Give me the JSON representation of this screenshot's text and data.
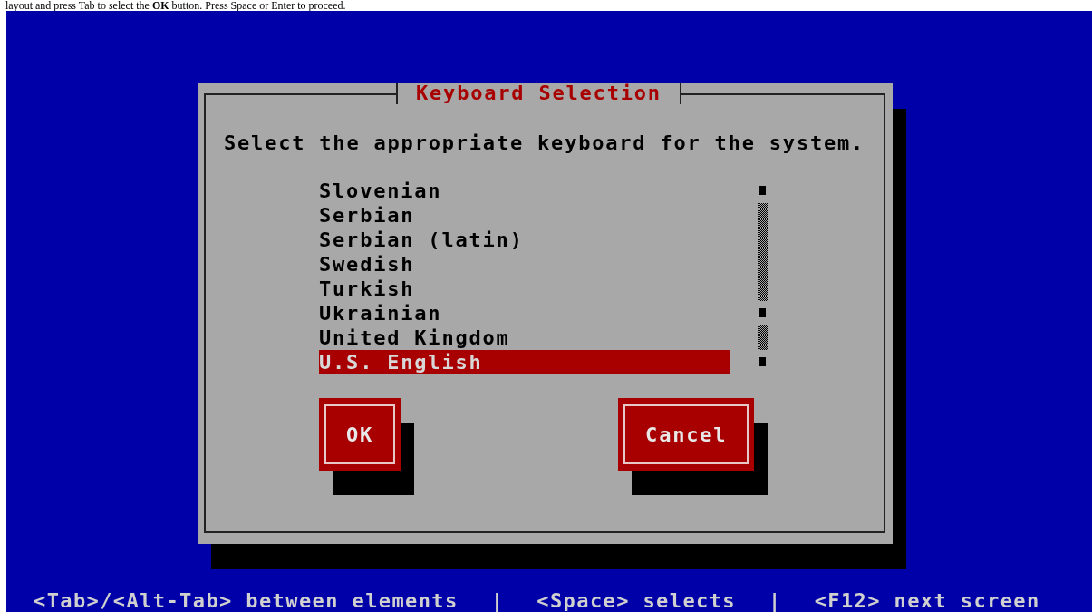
{
  "instruction": "layout and press Tab to select the **OK** button. Press Space or Enter to proceed.",
  "dialog": {
    "title": "Keyboard Selection",
    "prompt": "Select the appropriate keyboard for the system.",
    "options": [
      {
        "label": "Slovenian",
        "selected": false
      },
      {
        "label": "Serbian",
        "selected": false
      },
      {
        "label": "Serbian (latin)",
        "selected": false
      },
      {
        "label": "Swedish",
        "selected": false
      },
      {
        "label": "Turkish",
        "selected": false
      },
      {
        "label": "Ukrainian",
        "selected": false
      },
      {
        "label": "United Kingdom",
        "selected": false
      },
      {
        "label": "U.S. English",
        "selected": true
      }
    ],
    "buttons": [
      {
        "label": "OK"
      },
      {
        "label": "Cancel"
      }
    ]
  },
  "footer": [
    {
      "kind": "hint",
      "text": "<Tab>/<Alt-Tab> between elements"
    },
    {
      "kind": "separator",
      "text": "|"
    },
    {
      "kind": "hint",
      "text": "<Space> selects"
    },
    {
      "kind": "separator",
      "text": "|"
    },
    {
      "kind": "hint",
      "text": "<F12> next screen"
    }
  ]
}
